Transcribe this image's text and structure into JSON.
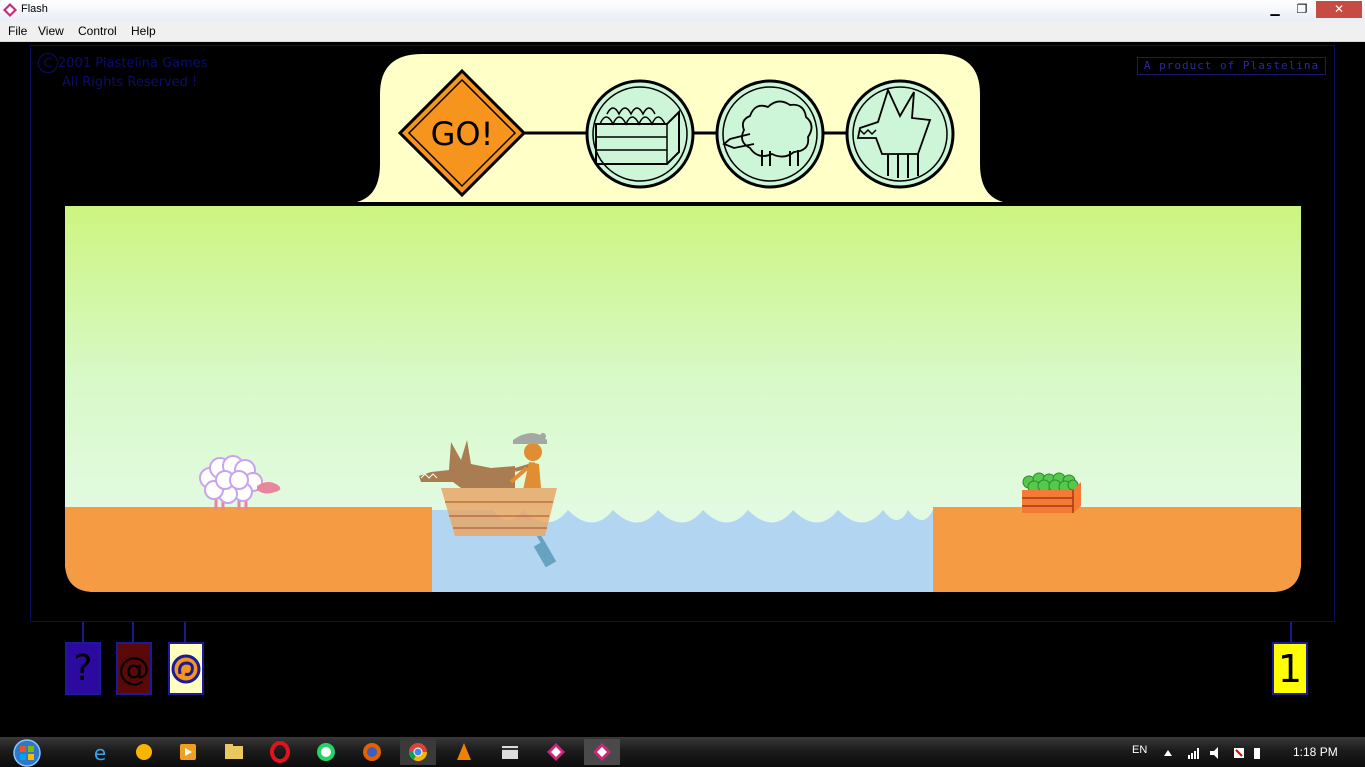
{
  "window": {
    "title": "Flash"
  },
  "menu": [
    "File",
    "View",
    "Control",
    "Help"
  ],
  "copyright": {
    "symbol": "C",
    "line1": "2001 Plastelina Games",
    "line2": "All Rights Reserved !"
  },
  "product": "A product of Plastelina",
  "progress": {
    "start_label": "GO!",
    "items": [
      "apples-crate-icon",
      "sheep-icon",
      "wolf-icon"
    ]
  },
  "buttons": {
    "help": "?",
    "contact": "@",
    "logo": "plastelina-logo-icon"
  },
  "level": "1",
  "colors": {
    "sky_top": "#ccf57f",
    "sky_bottom": "#e8fbf0",
    "ground": "#f49b44",
    "water": "#b2d6f2",
    "panel": "#ffffc8",
    "go_sign": "#f7941d",
    "token": "#cdf5d7"
  },
  "taskbar": {
    "lang": "EN",
    "time": "1:18 PM"
  }
}
